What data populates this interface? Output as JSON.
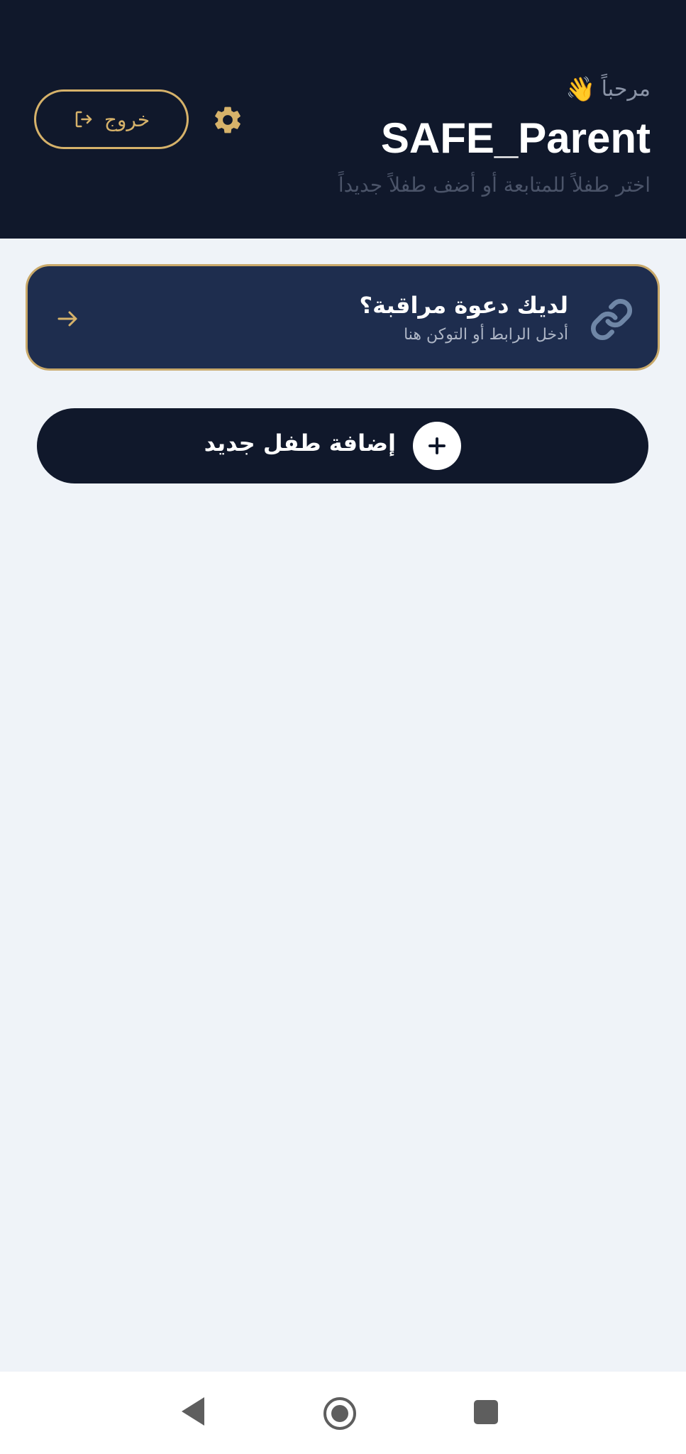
{
  "header": {
    "greeting": "مرحباً",
    "greeting_icon": "waving-hand-icon",
    "app_title": "SAFE_Parent",
    "subtitle": "اختر طفلاً للمتابعة أو أضف طفلاً جديداً",
    "logout_label": "خروج",
    "logout_icon": "logout-icon",
    "settings_icon": "gear-icon"
  },
  "invite_card": {
    "title": "لديك دعوة مراقبة؟",
    "subtitle": "أدخل الرابط أو التوكن هنا",
    "icon": "link-icon",
    "action_icon": "arrow-right-icon"
  },
  "add_child": {
    "label": "إضافة طفل جديد",
    "icon": "plus-icon"
  },
  "nav": {
    "back_icon": "back-triangle-icon",
    "home_icon": "home-circle-icon",
    "recents_icon": "recents-square-icon"
  },
  "colors": {
    "header_bg": "#10182B",
    "page_bg": "#EFF3F8",
    "accent_gold": "#D6B26A",
    "card_bg": "#1E2D4E",
    "link_icon": "#6F86A6"
  }
}
